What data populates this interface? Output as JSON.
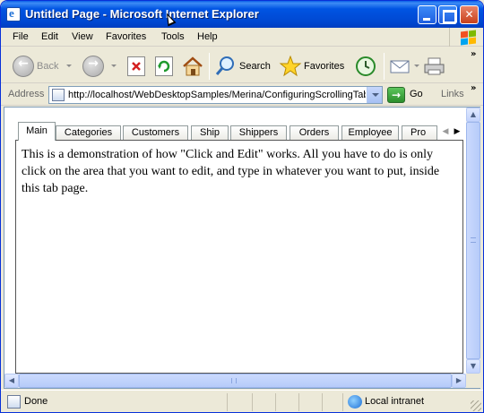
{
  "window": {
    "title": "Untitled Page - Microsoft Internet Explorer",
    "controls": {
      "minimize": "minimize",
      "maximize": "maximize",
      "close": "✕"
    }
  },
  "menu": {
    "items": [
      "File",
      "Edit",
      "View",
      "Favorites",
      "Tools",
      "Help"
    ]
  },
  "toolbar": {
    "back_label": "Back",
    "search_label": "Search",
    "favorites_label": "Favorites",
    "overflow": "»"
  },
  "address": {
    "label": "Address",
    "url": "http://localhost/WebDesktopSamples/Merina/ConfiguringScrollingTabPage",
    "go_label": "Go",
    "links_label": "Links"
  },
  "tabs": {
    "items": [
      "Main",
      "Categories",
      "Customers",
      "Ship",
      "Shippers",
      "Orders",
      "Employee",
      "Pro"
    ],
    "selected": "Main",
    "scroll_left": "◀",
    "scroll_right": "▶"
  },
  "tab_page": {
    "text": "This is a demonstration of how \"Click and Edit\" works. All you have to do is only click on the area that you want to edit, and type in whatever you want to put, inside this tab page."
  },
  "status": {
    "text": "Done",
    "zone": "Local intranet"
  },
  "colors": {
    "titlebar": "#0054e3",
    "window_bg": "#ece9d8",
    "scrollbar": "#c3d3fd"
  }
}
